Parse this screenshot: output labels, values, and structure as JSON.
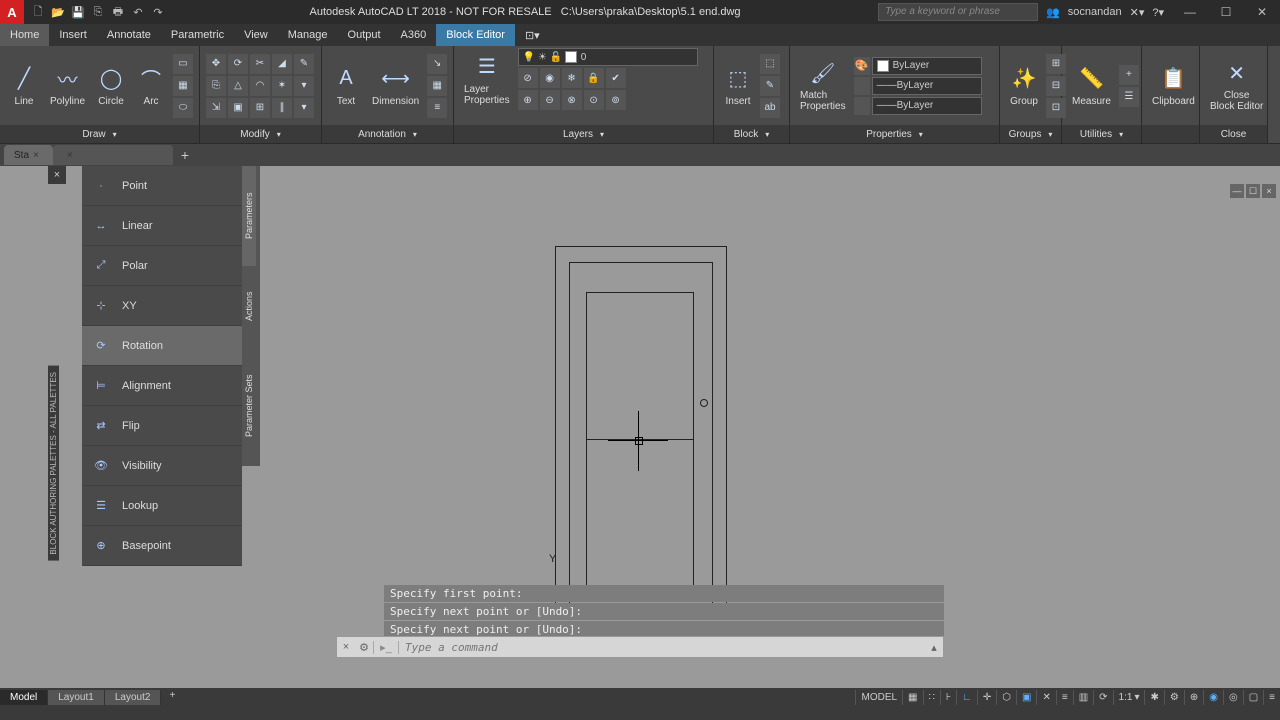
{
  "title": {
    "app": "Autodesk AutoCAD LT 2018 - NOT FOR RESALE",
    "path": "C:\\Users\\praka\\Desktop\\5.1 end.dwg",
    "search_placeholder": "Type a keyword or phrase",
    "user": "socnandan"
  },
  "ribtabs": [
    "Home",
    "Insert",
    "Annotate",
    "Parametric",
    "View",
    "Manage",
    "Output",
    "A360",
    "Block Editor"
  ],
  "panels": {
    "draw": {
      "label": "Draw",
      "line": "Line",
      "polyline": "Polyline",
      "circle": "Circle",
      "arc": "Arc"
    },
    "modify": {
      "label": "Modify"
    },
    "annotation": {
      "label": "Annotation",
      "text": "Text",
      "dimension": "Dimension"
    },
    "layers": {
      "label": "Layers",
      "layerprops": "Layer\nProperties",
      "current": "0"
    },
    "block": {
      "label": "Block",
      "insert": "Insert"
    },
    "properties": {
      "label": "Properties",
      "match": "Match\nProperties",
      "layer": "ByLayer",
      "line1": "ByLayer",
      "line2": "ByLayer"
    },
    "groups": {
      "label": "Groups",
      "group": "Group"
    },
    "utilities": {
      "label": "Utilities",
      "measure": "Measure"
    },
    "clipboard": {
      "label": "",
      "clipboard": "Clipboard"
    },
    "close": {
      "label": "Close",
      "close": "Close\nBlock Editor"
    }
  },
  "filetab": {
    "name": "Sta",
    "plus": "+"
  },
  "palette": {
    "title": "BLOCK AUTHORING PALETTES - ALL PALETTES",
    "tabs": [
      "Parameters",
      "Actions",
      "Parameter Sets"
    ],
    "items": [
      "Point",
      "Linear",
      "Polar",
      "XY",
      "Rotation",
      "Alignment",
      "Flip",
      "Visibility",
      "Lookup",
      "Basepoint"
    ]
  },
  "cmd": {
    "h1": "Specify first point:",
    "h2": "Specify next point or [Undo]:",
    "h3": "Specify next point or [Undo]:",
    "placeholder": "Type a command"
  },
  "status": {
    "tabs": [
      "Model",
      "Layout1",
      "Layout2"
    ],
    "model": "MODEL",
    "scale": "1:1"
  }
}
